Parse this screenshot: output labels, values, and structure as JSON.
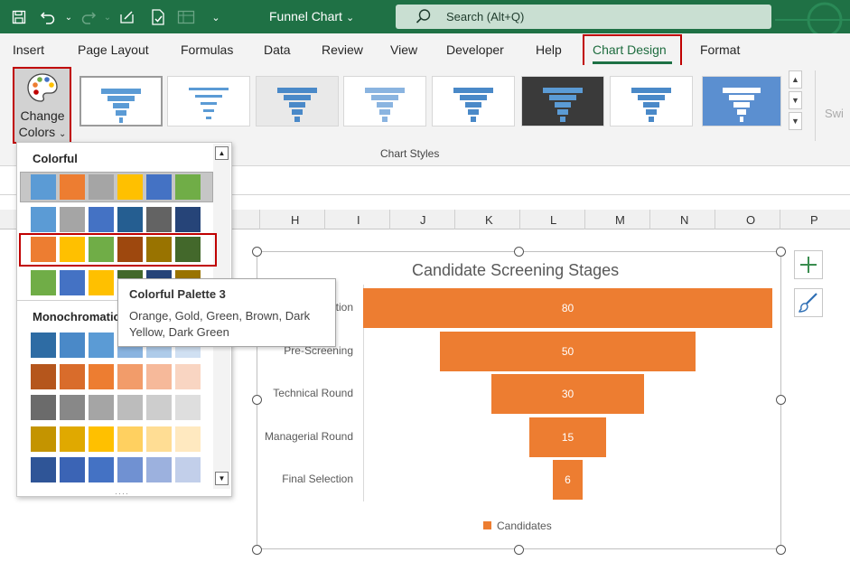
{
  "titlebar": {
    "doc_title": "Funnel Chart",
    "search_placeholder": "Search (Alt+Q)"
  },
  "tabs": [
    "Insert",
    "Page Layout",
    "Formulas",
    "Data",
    "Review",
    "View",
    "Developer",
    "Help",
    "Chart Design",
    "Format"
  ],
  "active_tab": "Chart Design",
  "ribbon": {
    "change_colors_line1": "Change",
    "change_colors_line2": "Colors",
    "change_colors_chevron": "⌄",
    "group_label": "Chart Styles",
    "clipped_switch_label": "Swi"
  },
  "columns": [
    "H",
    "I",
    "J",
    "K",
    "L",
    "M",
    "N",
    "O",
    "P"
  ],
  "color_dropdown": {
    "colorful_heading": "Colorful",
    "monochromatic_heading": "Monochromatic",
    "colorful_rows": [
      [
        "#5b9bd5",
        "#ed7d31",
        "#a5a5a5",
        "#ffc000",
        "#4472c4",
        "#70ad47"
      ],
      [
        "#5b9bd5",
        "#a5a5a5",
        "#4472c4",
        "#255e91",
        "#636363",
        "#264478"
      ],
      [
        "#ed7d31",
        "#ffc000",
        "#70ad47",
        "#9e480e",
        "#997300",
        "#43682b"
      ],
      [
        "#70ad47",
        "#4472c4",
        "#ffc000",
        "#43682b",
        "#264478",
        "#997300"
      ]
    ],
    "monochromatic_rows": [
      [
        "#2e6ca4",
        "#4a89c8",
        "#5b9bd5",
        "#8ab4e0",
        "#aecbe9",
        "#d0e0f2"
      ],
      [
        "#b5561c",
        "#d96c2b",
        "#ed7d31",
        "#f29c6a",
        "#f6b99a",
        "#f9d5c2"
      ],
      [
        "#6b6b6b",
        "#888888",
        "#a5a5a5",
        "#bcbcbc",
        "#cdcdcd",
        "#dedede"
      ],
      [
        "#c49400",
        "#e0a900",
        "#ffc000",
        "#ffd060",
        "#ffdd94",
        "#ffe9c0"
      ],
      [
        "#2f5597",
        "#3b64b5",
        "#4472c4",
        "#7091d2",
        "#9cb1de",
        "#c2cfea"
      ]
    ]
  },
  "tooltip": {
    "title": "Colorful Palette 3",
    "description": "Orange, Gold, Green, Brown, Dark Yellow, Dark Green"
  },
  "chart_data": {
    "type": "bar",
    "subtype": "funnel",
    "title": "Candidate Screening Stages",
    "categories": [
      "Application",
      "Pre-Screening",
      "Technical Round",
      "Managerial Round",
      "Final Selection"
    ],
    "series": [
      {
        "name": "Candidates",
        "values": [
          80,
          50,
          30,
          15,
          6
        ],
        "color": "#ed7d31"
      }
    ],
    "xlim": [
      0,
      80
    ],
    "grid": false,
    "legend": "bottom",
    "data_labels": true
  }
}
